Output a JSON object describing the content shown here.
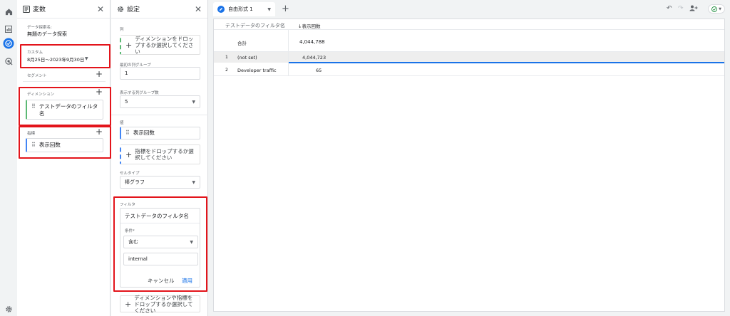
{
  "variables_panel": {
    "title": "変数",
    "exploration_name_label": "データ探索名:",
    "exploration_name": "無題のデータ探索",
    "date_label": "カスタム",
    "date_range": "8月25日〜2023年9月30日",
    "segments_label": "セグメント",
    "dimensions_label": "ディメンション",
    "dimension_item": "テストデータのフィルタ名",
    "metrics_label": "指標",
    "metric_item": "表示回数"
  },
  "settings_panel": {
    "title": "設定",
    "columns_label": "列",
    "columns_drop": "ディメンションをドロップするか選択してください",
    "first_col_group_label": "最初の列グループ",
    "first_col_group_value": "1",
    "show_col_groups_label": "表示する列グループ数",
    "show_col_groups_value": "5",
    "values_label": "値",
    "value_item": "表示回数",
    "values_drop": "指標をドロップするか選択してください",
    "cell_type_label": "セルタイプ",
    "cell_type_value": "棒グラフ",
    "filters_label": "フィルタ",
    "filter_dimension": "テストデータのフィルタ名",
    "condition_label": "条件*",
    "condition_value": "含む",
    "condition_input": "internal",
    "cancel_label": "キャンセル",
    "apply_label": "適用",
    "filters_drop": "ディメンションや指標をドロップするか選択してください"
  },
  "topbar": {
    "tab_label": "自由形式 1"
  },
  "table": {
    "dimension_header": "テストデータのフィルタ名",
    "metric_header": "↓表示回数",
    "total_label": "合計",
    "total_value": "4,044,788",
    "rows": [
      {
        "index": "1",
        "name": "(not set)",
        "value": "4,044,723"
      },
      {
        "index": "2",
        "name": "Developer traffic",
        "value": "65"
      }
    ]
  },
  "colors": {
    "accent": "#1a73e8",
    "highlight_box": "#e3141b",
    "dimension_chip": "#5bb974",
    "metric_chip": "#4285f4"
  }
}
